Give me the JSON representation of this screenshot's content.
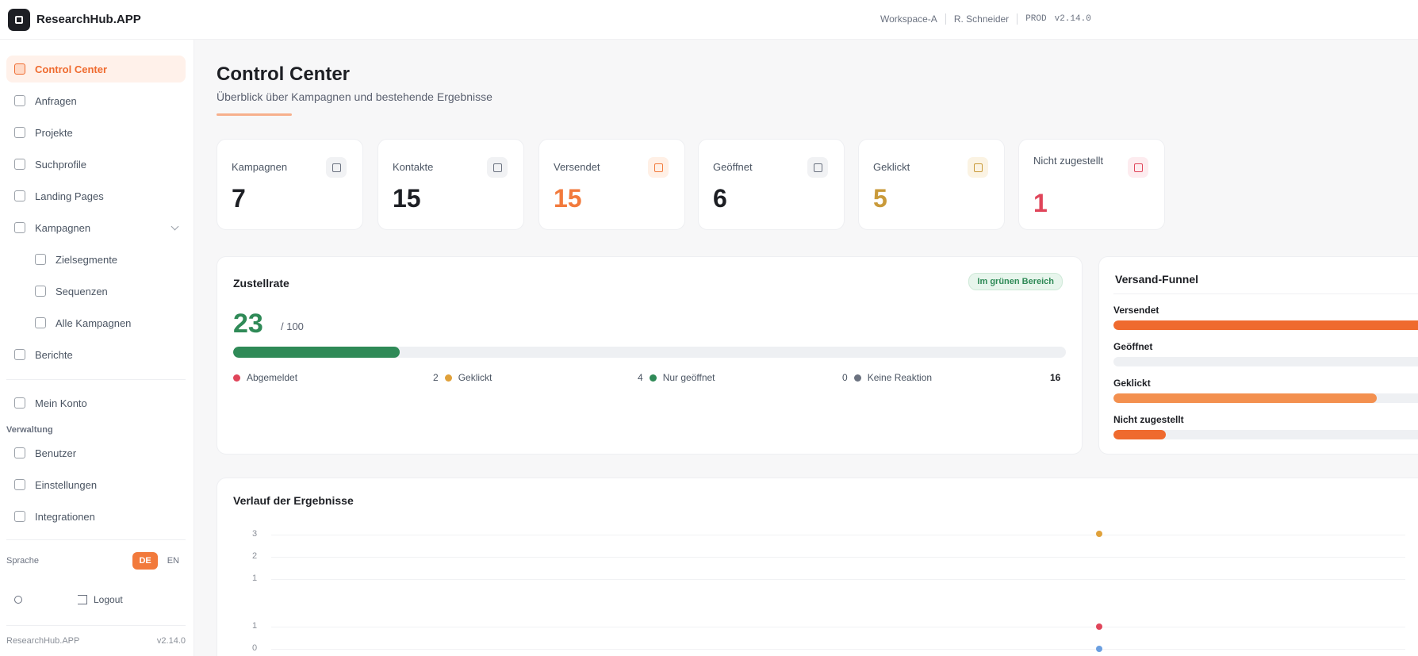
{
  "app": {
    "name": "ResearchHub.APP"
  },
  "topbar": {
    "workspace": "Workspace-A",
    "user": "R. Schneider",
    "env": "PROD",
    "build": "v2.14.0"
  },
  "sidebar": {
    "items": [
      {
        "label": "Control Center",
        "active": true
      },
      {
        "label": "Anfragen"
      },
      {
        "label": "Projekte"
      },
      {
        "label": "Suchprofile"
      },
      {
        "label": "Landing Pages"
      },
      {
        "label": "Kampagnen"
      }
    ],
    "sub_items": [
      {
        "label": "Zielsegmente"
      },
      {
        "label": "Sequenzen"
      },
      {
        "label": "Alle Kampagnen"
      }
    ],
    "after_items": [
      {
        "label": "Berichte"
      }
    ],
    "secondary_items": [
      {
        "label": "Mein Konto"
      }
    ],
    "section_label": "Verwaltung",
    "admin_items": [
      {
        "label": "Benutzer"
      },
      {
        "label": "Einstellungen"
      },
      {
        "label": "Integrationen"
      }
    ],
    "language": {
      "label": "Sprache",
      "options": [
        "DE",
        "EN"
      ],
      "selected": "DE"
    },
    "logout_label": "Logout",
    "version_name": "ResearchHub.APP",
    "version": "v2.14.0"
  },
  "page": {
    "title": "Control Center",
    "subtitle": "Überblick über Kampagnen und bestehende Ergebnisse"
  },
  "stats": [
    {
      "label": "Kampagnen",
      "value": "7",
      "color": "#1d1f24",
      "icon": "campaign-icon",
      "icon_color": "#6b7280",
      "icon_bg": "#f1f2f4"
    },
    {
      "label": "Kontakte",
      "value": "15",
      "color": "#1d1f24",
      "icon": "contacts-icon",
      "icon_color": "#6b7280",
      "icon_bg": "#f1f2f4"
    },
    {
      "label": "Versendet",
      "value": "15",
      "color": "#f27a3c",
      "icon": "send-icon",
      "icon_color": "#f27a3c",
      "icon_bg": "#fff0e6"
    },
    {
      "label": "Geöffnet",
      "value": "6",
      "color": "#1d1f24",
      "icon": "open-icon",
      "icon_color": "#6b7280",
      "icon_bg": "#f1f2f4"
    },
    {
      "label": "Geklickt",
      "value": "5",
      "color": "#c99a3a",
      "icon": "click-icon",
      "icon_color": "#c99a3a",
      "icon_bg": "#fbf3e3"
    },
    {
      "label": "Nicht zugestellt",
      "value": "1",
      "color": "#e0455a",
      "icon": "bounce-icon",
      "icon_color": "#e0455a",
      "icon_bg": "#fdecef"
    }
  ],
  "delivery": {
    "title": "Zustellrate",
    "badge": "Im grünen Bereich",
    "rate": "23",
    "unit": "/ 100",
    "fill_fraction": 0.2,
    "legend": [
      {
        "label": "Abgemeldet",
        "count": "2",
        "color": "#e0455a"
      },
      {
        "label": "Geklickt",
        "count": "4",
        "color": "#e0a13a"
      },
      {
        "label": "Nur geöffnet",
        "count": "0",
        "color": "#2f8a57"
      },
      {
        "label": "Keine Reaktion",
        "count": "16",
        "color": "#6b7280"
      }
    ]
  },
  "status_panel": {
    "title": "Versand-Funnel",
    "rows": [
      {
        "label": "Versendet",
        "fraction": 1.0,
        "color": "#ef6a2e"
      },
      {
        "label": "Geöffnet",
        "fraction": 0.0,
        "color": "#ef6a2e"
      },
      {
        "label": "Geklickt",
        "fraction": 0.85,
        "color": "#f3904f"
      },
      {
        "label": "Nicht zugestellt",
        "fraction": 0.17,
        "color": "#ef6a2e"
      }
    ]
  },
  "trend": {
    "title": "Verlauf der Ergebnisse",
    "y_ticks": [
      "3",
      "2",
      "1",
      "1",
      "0"
    ]
  }
}
